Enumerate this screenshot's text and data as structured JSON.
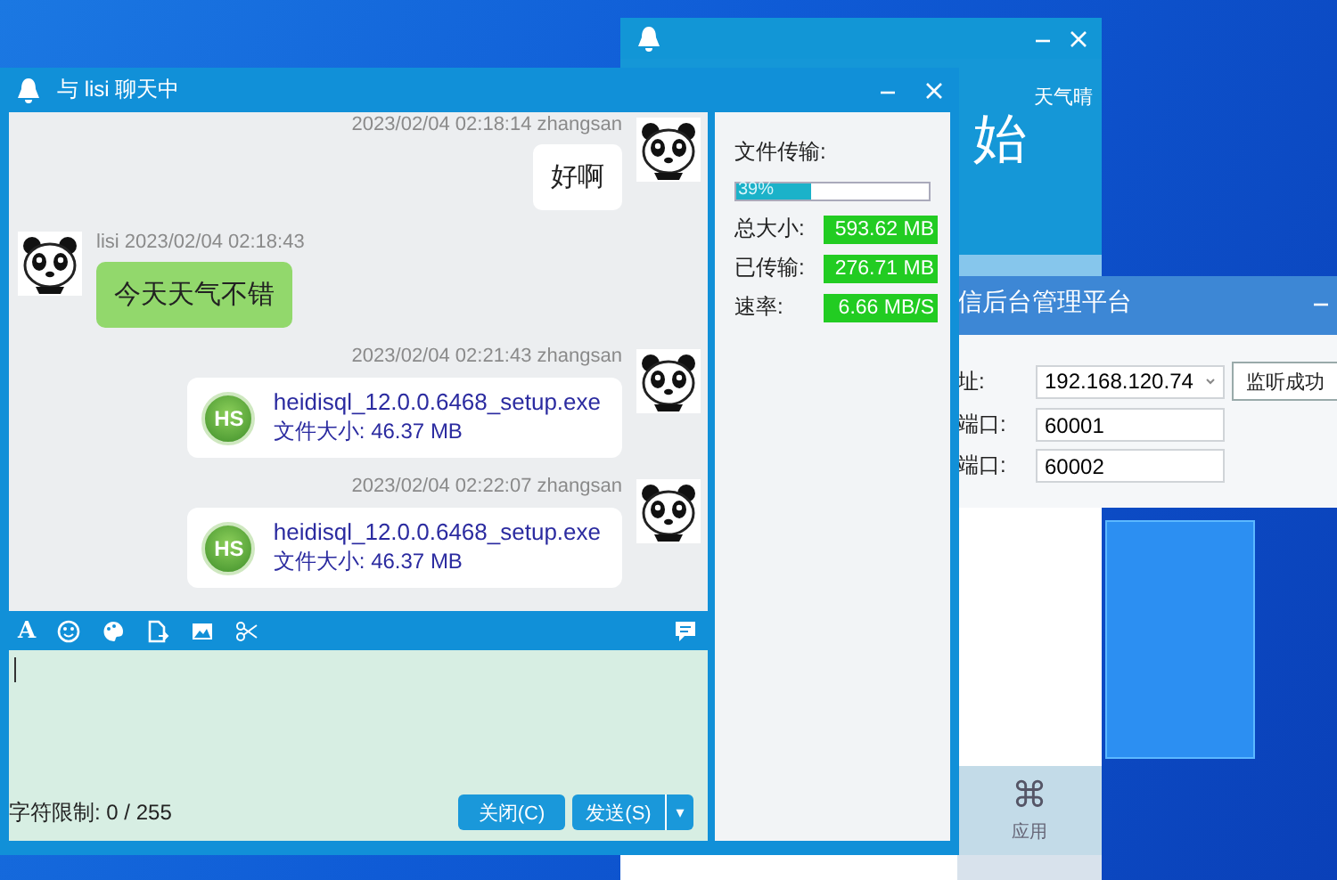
{
  "back_window": {
    "heading": "始",
    "weather": "天气晴",
    "app_icon": "⌘",
    "app_label": "应用"
  },
  "admin_window": {
    "title": "信后台管理平台",
    "button": "监听成功",
    "fields": [
      {
        "label": "址:",
        "value": "192.168.120.74",
        "kind": "dropdown"
      },
      {
        "label": "端口:",
        "value": "60001",
        "kind": "text"
      },
      {
        "label": "端口:",
        "value": "60002",
        "kind": "text"
      }
    ]
  },
  "chat_window": {
    "title": "与 lisi 聊天中",
    "messages": [
      {
        "outgoing": true,
        "sender": "zhangsan",
        "time": "2023/02/04 02:18:14",
        "kind": "text",
        "text": "好啊"
      },
      {
        "outgoing": false,
        "sender": "lisi",
        "time": "2023/02/04 02:18:43",
        "kind": "text",
        "text": "今天天气不错"
      },
      {
        "outgoing": true,
        "sender": "zhangsan",
        "time": "2023/02/04 02:21:43",
        "kind": "file",
        "icon_text": "HS",
        "file_name": "heidisql_12.0.0.6468_setup.exe",
        "file_size": "文件大小: 46.37 MB"
      },
      {
        "outgoing": true,
        "sender": "zhangsan",
        "time": "2023/02/04 02:22:07",
        "kind": "file",
        "icon_text": "HS",
        "file_name": "heidisql_12.0.0.6468_setup.exe",
        "file_size": "文件大小: 46.37 MB"
      }
    ],
    "toolbar": {
      "font_button": "A"
    },
    "char_limit": "字符限制: 0 / 255",
    "buttons": [
      {
        "label": "关闭(C)",
        "kind": "plain"
      },
      {
        "label": "发送(S)",
        "kind": "split",
        "caret": "▾"
      }
    ],
    "transfer": {
      "heading": "文件传输:",
      "progress_label": "39%",
      "level": 0.39,
      "stats": [
        {
          "label": "总大小:",
          "value": "593.62 MB"
        },
        {
          "label": "已传输:",
          "value": "276.71 MB"
        },
        {
          "label": "速率:",
          "value": "6.66 MB/S"
        }
      ]
    }
  }
}
